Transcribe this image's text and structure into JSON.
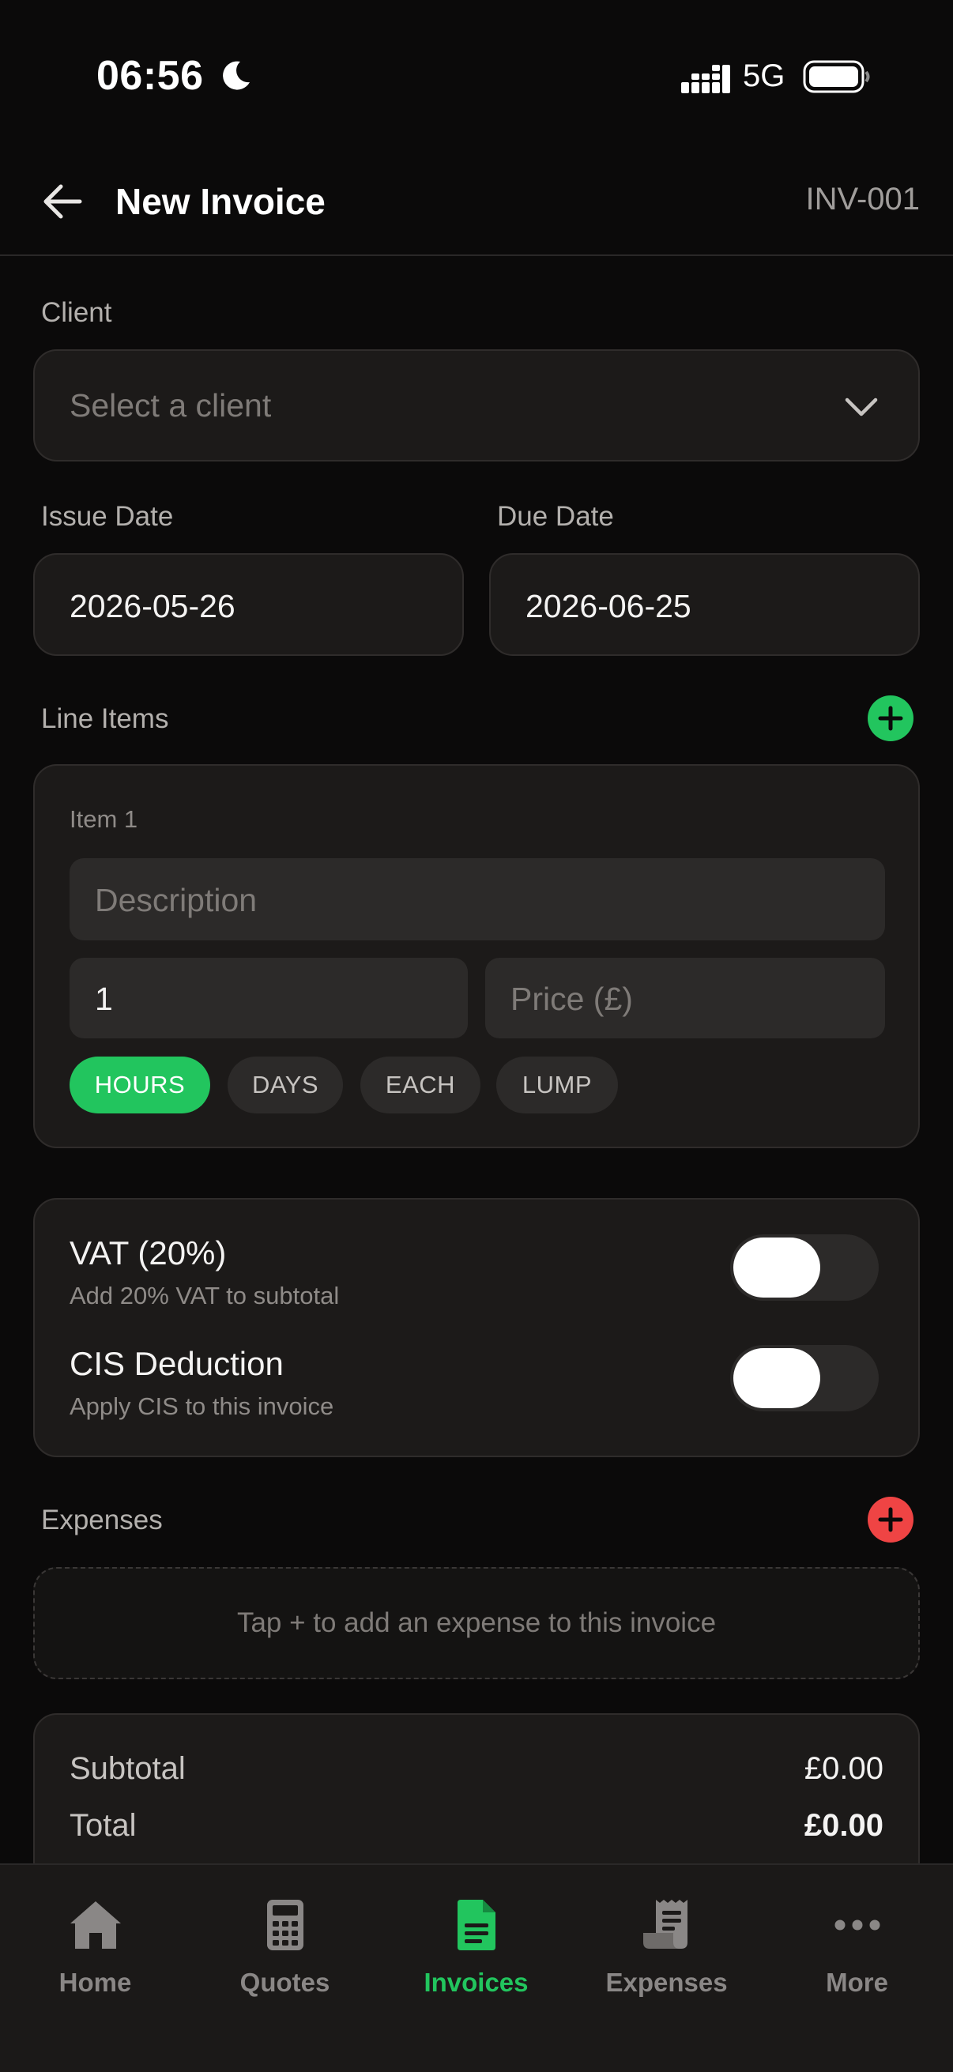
{
  "status_bar": {
    "time": "06:56",
    "network": "5G"
  },
  "header": {
    "title": "New Invoice",
    "invoice_number": "INV-001"
  },
  "client": {
    "label": "Client",
    "placeholder": "Select a client"
  },
  "issue_date": {
    "label": "Issue Date",
    "value": "2026-05-26"
  },
  "due_date": {
    "label": "Due Date",
    "value": "2026-06-25"
  },
  "line_items": {
    "label": "Line Items",
    "items": [
      {
        "title": "Item 1",
        "description_placeholder": "Description",
        "quantity": "1",
        "price_placeholder": "Price (£)",
        "units": [
          "HOURS",
          "DAYS",
          "EACH",
          "LUMP"
        ],
        "selected_unit": "HOURS"
      }
    ]
  },
  "vat": {
    "title": "VAT (20%)",
    "subtitle": "Add 20% VAT to subtotal",
    "enabled": false
  },
  "cis": {
    "title": "CIS Deduction",
    "subtitle": "Apply CIS to this invoice",
    "enabled": false
  },
  "expenses": {
    "label": "Expenses",
    "empty_text": "Tap + to add an expense to this invoice"
  },
  "totals": {
    "subtotal_label": "Subtotal",
    "subtotal_value": "£0.00",
    "total_label": "Total",
    "total_value": "£0.00"
  },
  "nav": {
    "items": [
      {
        "label": "Home",
        "icon": "home-icon"
      },
      {
        "label": "Quotes",
        "icon": "calculator-icon"
      },
      {
        "label": "Invoices",
        "icon": "invoice-document-icon"
      },
      {
        "label": "Expenses",
        "icon": "receipt-icon"
      },
      {
        "label": "More",
        "icon": "more-dots-icon"
      }
    ],
    "active": "Invoices"
  },
  "colors": {
    "accent": "#22c55e",
    "danger": "#ef4444",
    "background": "#0b0a0a",
    "card": "#1c1a19"
  }
}
